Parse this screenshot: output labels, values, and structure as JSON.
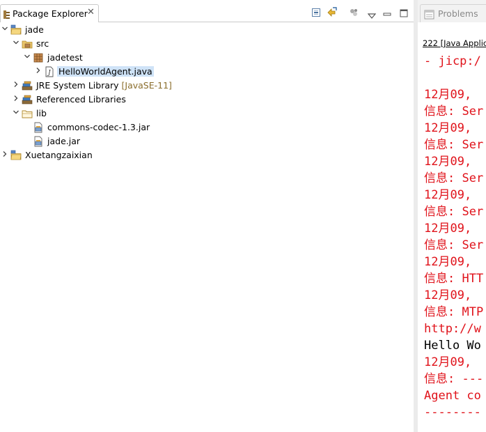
{
  "left_view": {
    "tab_label": "Package Explorer",
    "close_glyph": "✕",
    "toolbar": [
      "collapse-all-icon",
      "link-with-editor-icon",
      "filters-icon",
      "view-menu-icon",
      "minimize-icon",
      "maximize-icon"
    ],
    "tree": [
      {
        "label": "jade",
        "decoration": "",
        "expanded": true,
        "icon": "java-project-icon"
      },
      {
        "label": "src",
        "decoration": "",
        "expanded": true,
        "icon": "source-folder-icon"
      },
      {
        "label": "jadetest",
        "decoration": "",
        "expanded": true,
        "icon": "package-icon"
      },
      {
        "label": "HelloWorldAgent.java",
        "decoration": "",
        "expanded": false,
        "icon": "java-file-icon",
        "selected": true
      },
      {
        "label": "JRE System Library",
        "decoration": "[JavaSE-11]",
        "expanded": false,
        "icon": "library-icon"
      },
      {
        "label": "Referenced Libraries",
        "decoration": "",
        "expanded": false,
        "icon": "library-icon"
      },
      {
        "label": "lib",
        "decoration": "",
        "expanded": true,
        "icon": "folder-icon"
      },
      {
        "label": "commons-codec-1.3.jar",
        "decoration": "",
        "expanded": false,
        "icon": "jar-icon"
      },
      {
        "label": "jade.jar",
        "decoration": "",
        "expanded": false,
        "icon": "jar-icon"
      },
      {
        "label": "Xuetangzaixian",
        "decoration": "",
        "expanded": false,
        "icon": "java-project-icon"
      }
    ]
  },
  "right_view": {
    "tab_label": "Problems",
    "console_description": "222 [Java Applic",
    "lines": [
      {
        "text": "- jicp:/",
        "color": "red"
      },
      {
        "text": "",
        "color": "red"
      },
      {
        "text": "12月09, ",
        "color": "red"
      },
      {
        "text": "信息: Ser",
        "color": "red"
      },
      {
        "text": "12月09, ",
        "color": "red"
      },
      {
        "text": "信息: Ser",
        "color": "red"
      },
      {
        "text": "12月09, ",
        "color": "red"
      },
      {
        "text": "信息: Ser",
        "color": "red"
      },
      {
        "text": "12月09, ",
        "color": "red"
      },
      {
        "text": "信息: Ser",
        "color": "red"
      },
      {
        "text": "12月09, ",
        "color": "red"
      },
      {
        "text": "信息: Ser",
        "color": "red"
      },
      {
        "text": "12月09, ",
        "color": "red"
      },
      {
        "text": "信息: HTT",
        "color": "red"
      },
      {
        "text": "12月09, ",
        "color": "red"
      },
      {
        "text": "信息: MTP",
        "color": "red"
      },
      {
        "text": "http://w",
        "color": "red"
      },
      {
        "text": "Hello Wo",
        "color": "black"
      },
      {
        "text": "12月09, ",
        "color": "red"
      },
      {
        "text": "信息: ---",
        "color": "red"
      },
      {
        "text": "Agent co",
        "color": "red"
      },
      {
        "text": "--------",
        "color": "red"
      }
    ]
  },
  "colors": {
    "console_error": "#e0121a",
    "selection": "#cfe3f7",
    "decoration": "#8a6d2b"
  }
}
